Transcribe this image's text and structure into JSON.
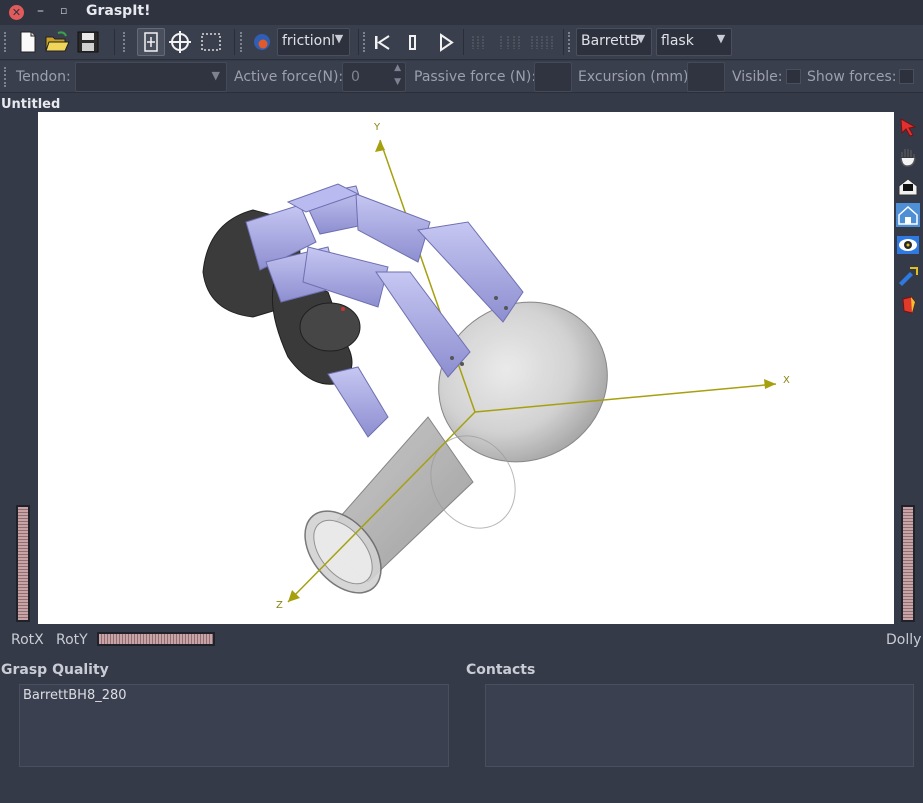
{
  "window": {
    "title": "GraspIt!"
  },
  "toolbar": {
    "quality_combo": "frictionl",
    "hand_combo": "BarrettB",
    "object_combo": "flask"
  },
  "tendonbar": {
    "tendon_label": "Tendon:",
    "tendon_value": "",
    "active_force_label": "Active force(N):",
    "active_force_value": "0",
    "passive_force_label": "Passive force (N):",
    "passive_force_value": "",
    "excursion_label": "Excursion (mm):",
    "excursion_value": "",
    "visible_label": "Visible:",
    "show_forces_label": "Show forces:"
  },
  "viewport": {
    "document_title": "Untitled",
    "axis_x": "X",
    "axis_y": "Y",
    "axis_z": "Z",
    "background": "#ffffff"
  },
  "wheels": {
    "rotx_label": "RotX",
    "roty_label": "RotY",
    "dolly_label": "Dolly"
  },
  "panels": {
    "grasp_quality_title": "Grasp Quality",
    "contacts_title": "Contacts",
    "grasp_quality_items": [
      "BarrettBH8_280"
    ]
  },
  "colors": {
    "bg": "#353a48",
    "close": "#e25b5b",
    "axis": "#a6a00f",
    "hand": "#a9aae8",
    "palm": "#3a3a3a"
  },
  "icons": {
    "right_tools": [
      "select-arrow-icon",
      "hand-icon",
      "camera-home-icon",
      "set-home-icon",
      "view-all-icon",
      "seek-flashlight-icon",
      "perspective-icon"
    ]
  }
}
